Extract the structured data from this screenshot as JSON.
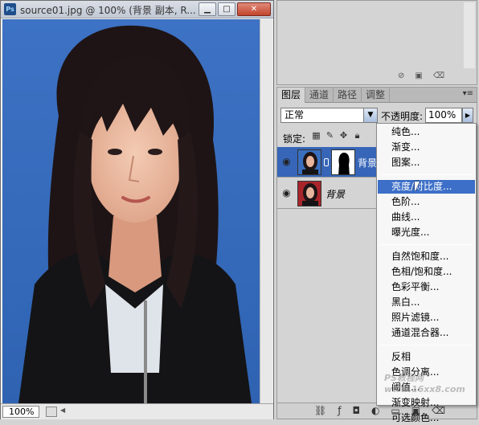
{
  "document": {
    "title": "source01.jpg @ 100% (背景 副本, R...",
    "logo_text": "Ps",
    "window_buttons": {
      "minimize": "▁",
      "maximize": "□",
      "close": "✕"
    },
    "zoom": "100%"
  },
  "layers_panel": {
    "tabs": [
      {
        "label": "图层"
      },
      {
        "label": "通道"
      },
      {
        "label": "路径"
      },
      {
        "label": "调整"
      }
    ],
    "blend_mode": "正常",
    "opacity_label": "不透明度:",
    "opacity_value": "100%",
    "lock_label": "锁定:",
    "layers": [
      {
        "name": "背景",
        "selected": true
      },
      {
        "name": "背景",
        "selected": false
      }
    ]
  },
  "adjustment_menu": {
    "groups": [
      [
        "纯色...",
        "渐变...",
        "图案..."
      ],
      [
        "亮度/对比度...",
        "色阶...",
        "曲线...",
        "曝光度..."
      ],
      [
        "自然饱和度...",
        "色相/饱和度...",
        "色彩平衡...",
        "黑白...",
        "照片滤镜...",
        "通道混合器..."
      ],
      [
        "反相",
        "色调分离...",
        "阈值...",
        "渐变映射...",
        "可选颜色..."
      ]
    ],
    "highlighted": "亮度/对比度..."
  },
  "watermark": "PS教程网 www.16xx8.com",
  "colors": {
    "selection": "#3766b8",
    "menu_highlight": "#3d6fc8",
    "photo_background": "#3a6fbf"
  }
}
